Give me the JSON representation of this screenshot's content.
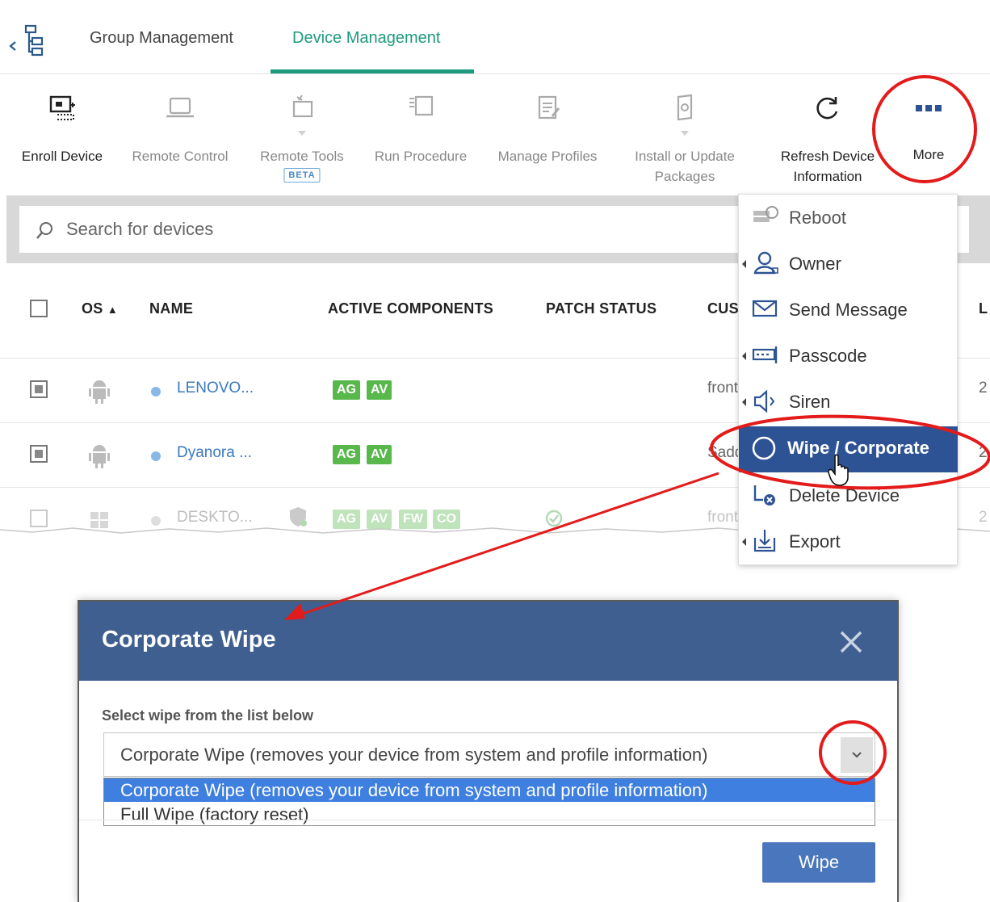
{
  "nav": {
    "tabs": [
      "Group Management",
      "Device Management"
    ],
    "active_tab": "Device Management",
    "accent_color": "#1e9a7e"
  },
  "toolbar": {
    "enroll": "Enroll Device",
    "remote_control": "Remote Control",
    "remote_tools": "Remote Tools",
    "beta": "BETA",
    "run_procedure": "Run Procedure",
    "manage_profiles": "Manage Profiles",
    "install_update": "Install or Update\nPackages",
    "refresh": "Refresh Device\nInformation",
    "more": "More"
  },
  "search": {
    "placeholder": "Search for devices"
  },
  "table": {
    "headers": {
      "os": "OS",
      "name": "NAME",
      "active_components": "ACTIVE COMPONENTS",
      "patch_status": "PATCH STATUS",
      "customer": "CUS",
      "last": "L"
    },
    "rows": [
      {
        "name": "LENOVO...",
        "badges": [
          "AG",
          "AV"
        ],
        "customer": "front",
        "last": "2"
      },
      {
        "name": "Dyanora ...",
        "badges": [
          "AG",
          "AV"
        ],
        "customer": "Sadd",
        "last": "2"
      },
      {
        "name": "DESKTO...",
        "badges": [
          "AG",
          "AV",
          "FW",
          "CO"
        ],
        "customer": "front",
        "last": "2"
      }
    ]
  },
  "more_menu": {
    "items": [
      "Reboot",
      "Owner",
      "Send Message",
      "Passcode",
      "Siren",
      "Wipe / Corporate",
      "Delete Device",
      "Export"
    ],
    "active_item": "Wipe / Corporate",
    "active_color": "#2d5394"
  },
  "dialog": {
    "title": "Corporate Wipe",
    "label": "Select wipe from the list below",
    "selected_value": "Corporate Wipe (removes your device from system and profile information)",
    "options": [
      "Corporate Wipe (removes your device from system and profile information)",
      "Full Wipe (factory reset)"
    ],
    "wipe_button": "Wipe",
    "header_color": "#3e5f90"
  },
  "annotation_color": "#e31b1b"
}
